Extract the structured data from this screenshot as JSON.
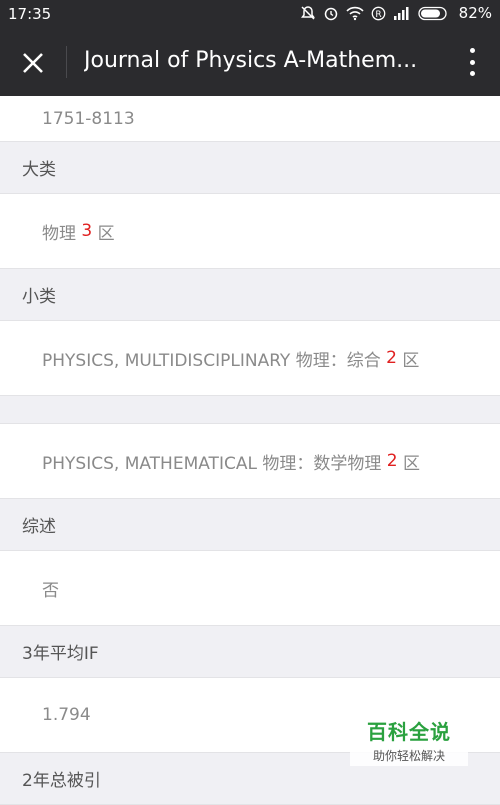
{
  "status_bar": {
    "time": "17:35",
    "battery": "82%"
  },
  "header": {
    "title": "Journal of Physics A-Mathem...",
    "close_icon": "close-icon",
    "more_icon": "more-vertical-icon"
  },
  "content": {
    "issn_value": "1751-8113",
    "major_category_label": "大类",
    "major_category_value": {
      "prefix": "物理 ",
      "rank": "3",
      "suffix": " 区"
    },
    "minor_category_label": "小类",
    "minor_category_1": {
      "prefix": "PHYSICS, MULTIDISCIPLINARY 物理：综合 ",
      "rank": "2",
      "suffix": " 区"
    },
    "minor_category_2": {
      "prefix": "PHYSICS, MATHEMATICAL 物理：数学物理 ",
      "rank": "2",
      "suffix": " 区"
    },
    "review_label": "综述",
    "review_value": "否",
    "avg_if_label": "3年平均IF",
    "avg_if_value": "1.794",
    "citations_label": "2年总被引"
  },
  "watermark": {
    "main": "百科全说",
    "sub": "助你轻松解决"
  },
  "colors": {
    "header_bg": "#2b2b2e",
    "rank_red": "#e02020",
    "watermark_green": "#2aa13f"
  }
}
